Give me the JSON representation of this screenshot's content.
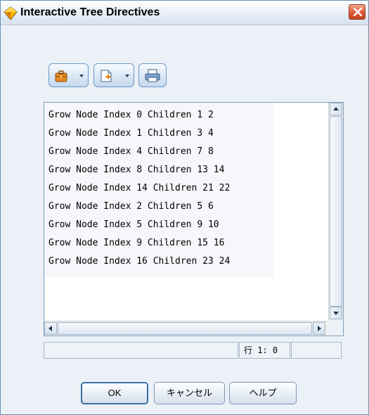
{
  "window": {
    "title": "Interactive Tree Directives"
  },
  "toolbar": {
    "buttons": [
      {
        "icon": "toolbox-icon",
        "has_dropdown": true
      },
      {
        "icon": "open-file-icon",
        "has_dropdown": true
      },
      {
        "icon": "print-icon",
        "has_dropdown": false
      }
    ]
  },
  "editor": {
    "lines": [
      "Grow Node Index 0 Children 1 2",
      "Grow Node Index 1 Children 3 4",
      "Grow Node Index 4 Children 7 8",
      "Grow Node Index 8 Children 13 14",
      "Grow Node Index 14 Children 21 22",
      "Grow Node Index 2 Children 5 6",
      "Grow Node Index 5 Children 9 10",
      "Grow Node Index 9 Children 15 16",
      "Grow Node Index 16 Children 23 24"
    ]
  },
  "status": {
    "position": "行 1: 0"
  },
  "buttons": {
    "ok": "OK",
    "cancel": "キャンセル",
    "help": "ヘルプ"
  },
  "colors": {
    "accent": "#3d6fa8",
    "dialog_background": "#ebf1f7",
    "close_button": "#d9542f"
  }
}
